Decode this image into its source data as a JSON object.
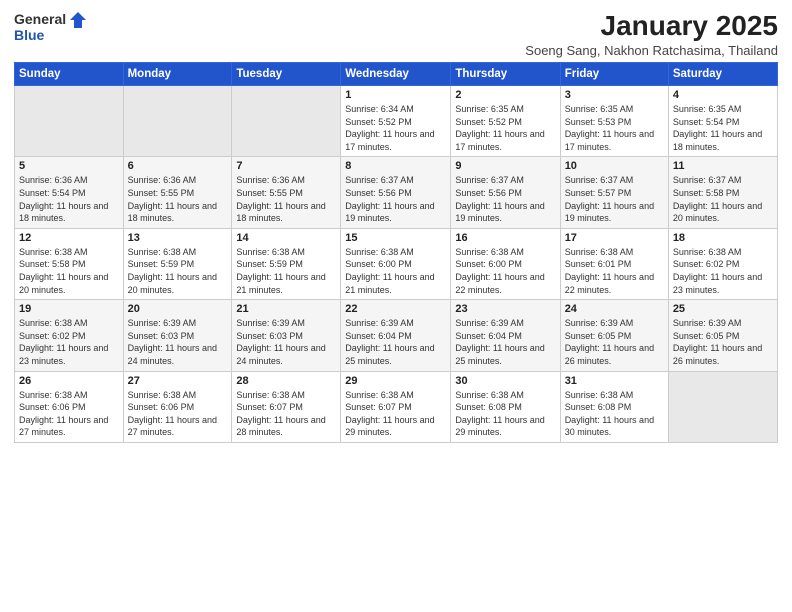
{
  "header": {
    "logo_general": "General",
    "logo_blue": "Blue",
    "title": "January 2025",
    "location": "Soeng Sang, Nakhon Ratchasima, Thailand"
  },
  "weekdays": [
    "Sunday",
    "Monday",
    "Tuesday",
    "Wednesday",
    "Thursday",
    "Friday",
    "Saturday"
  ],
  "weeks": [
    [
      {
        "day": "",
        "sunrise": "",
        "sunset": "",
        "daylight": ""
      },
      {
        "day": "",
        "sunrise": "",
        "sunset": "",
        "daylight": ""
      },
      {
        "day": "",
        "sunrise": "",
        "sunset": "",
        "daylight": ""
      },
      {
        "day": "1",
        "sunrise": "Sunrise: 6:34 AM",
        "sunset": "Sunset: 5:52 PM",
        "daylight": "Daylight: 11 hours and 17 minutes."
      },
      {
        "day": "2",
        "sunrise": "Sunrise: 6:35 AM",
        "sunset": "Sunset: 5:52 PM",
        "daylight": "Daylight: 11 hours and 17 minutes."
      },
      {
        "day": "3",
        "sunrise": "Sunrise: 6:35 AM",
        "sunset": "Sunset: 5:53 PM",
        "daylight": "Daylight: 11 hours and 17 minutes."
      },
      {
        "day": "4",
        "sunrise": "Sunrise: 6:35 AM",
        "sunset": "Sunset: 5:54 PM",
        "daylight": "Daylight: 11 hours and 18 minutes."
      }
    ],
    [
      {
        "day": "5",
        "sunrise": "Sunrise: 6:36 AM",
        "sunset": "Sunset: 5:54 PM",
        "daylight": "Daylight: 11 hours and 18 minutes."
      },
      {
        "day": "6",
        "sunrise": "Sunrise: 6:36 AM",
        "sunset": "Sunset: 5:55 PM",
        "daylight": "Daylight: 11 hours and 18 minutes."
      },
      {
        "day": "7",
        "sunrise": "Sunrise: 6:36 AM",
        "sunset": "Sunset: 5:55 PM",
        "daylight": "Daylight: 11 hours and 18 minutes."
      },
      {
        "day": "8",
        "sunrise": "Sunrise: 6:37 AM",
        "sunset": "Sunset: 5:56 PM",
        "daylight": "Daylight: 11 hours and 19 minutes."
      },
      {
        "day": "9",
        "sunrise": "Sunrise: 6:37 AM",
        "sunset": "Sunset: 5:56 PM",
        "daylight": "Daylight: 11 hours and 19 minutes."
      },
      {
        "day": "10",
        "sunrise": "Sunrise: 6:37 AM",
        "sunset": "Sunset: 5:57 PM",
        "daylight": "Daylight: 11 hours and 19 minutes."
      },
      {
        "day": "11",
        "sunrise": "Sunrise: 6:37 AM",
        "sunset": "Sunset: 5:58 PM",
        "daylight": "Daylight: 11 hours and 20 minutes."
      }
    ],
    [
      {
        "day": "12",
        "sunrise": "Sunrise: 6:38 AM",
        "sunset": "Sunset: 5:58 PM",
        "daylight": "Daylight: 11 hours and 20 minutes."
      },
      {
        "day": "13",
        "sunrise": "Sunrise: 6:38 AM",
        "sunset": "Sunset: 5:59 PM",
        "daylight": "Daylight: 11 hours and 20 minutes."
      },
      {
        "day": "14",
        "sunrise": "Sunrise: 6:38 AM",
        "sunset": "Sunset: 5:59 PM",
        "daylight": "Daylight: 11 hours and 21 minutes."
      },
      {
        "day": "15",
        "sunrise": "Sunrise: 6:38 AM",
        "sunset": "Sunset: 6:00 PM",
        "daylight": "Daylight: 11 hours and 21 minutes."
      },
      {
        "day": "16",
        "sunrise": "Sunrise: 6:38 AM",
        "sunset": "Sunset: 6:00 PM",
        "daylight": "Daylight: 11 hours and 22 minutes."
      },
      {
        "day": "17",
        "sunrise": "Sunrise: 6:38 AM",
        "sunset": "Sunset: 6:01 PM",
        "daylight": "Daylight: 11 hours and 22 minutes."
      },
      {
        "day": "18",
        "sunrise": "Sunrise: 6:38 AM",
        "sunset": "Sunset: 6:02 PM",
        "daylight": "Daylight: 11 hours and 23 minutes."
      }
    ],
    [
      {
        "day": "19",
        "sunrise": "Sunrise: 6:38 AM",
        "sunset": "Sunset: 6:02 PM",
        "daylight": "Daylight: 11 hours and 23 minutes."
      },
      {
        "day": "20",
        "sunrise": "Sunrise: 6:39 AM",
        "sunset": "Sunset: 6:03 PM",
        "daylight": "Daylight: 11 hours and 24 minutes."
      },
      {
        "day": "21",
        "sunrise": "Sunrise: 6:39 AM",
        "sunset": "Sunset: 6:03 PM",
        "daylight": "Daylight: 11 hours and 24 minutes."
      },
      {
        "day": "22",
        "sunrise": "Sunrise: 6:39 AM",
        "sunset": "Sunset: 6:04 PM",
        "daylight": "Daylight: 11 hours and 25 minutes."
      },
      {
        "day": "23",
        "sunrise": "Sunrise: 6:39 AM",
        "sunset": "Sunset: 6:04 PM",
        "daylight": "Daylight: 11 hours and 25 minutes."
      },
      {
        "day": "24",
        "sunrise": "Sunrise: 6:39 AM",
        "sunset": "Sunset: 6:05 PM",
        "daylight": "Daylight: 11 hours and 26 minutes."
      },
      {
        "day": "25",
        "sunrise": "Sunrise: 6:39 AM",
        "sunset": "Sunset: 6:05 PM",
        "daylight": "Daylight: 11 hours and 26 minutes."
      }
    ],
    [
      {
        "day": "26",
        "sunrise": "Sunrise: 6:38 AM",
        "sunset": "Sunset: 6:06 PM",
        "daylight": "Daylight: 11 hours and 27 minutes."
      },
      {
        "day": "27",
        "sunrise": "Sunrise: 6:38 AM",
        "sunset": "Sunset: 6:06 PM",
        "daylight": "Daylight: 11 hours and 27 minutes."
      },
      {
        "day": "28",
        "sunrise": "Sunrise: 6:38 AM",
        "sunset": "Sunset: 6:07 PM",
        "daylight": "Daylight: 11 hours and 28 minutes."
      },
      {
        "day": "29",
        "sunrise": "Sunrise: 6:38 AM",
        "sunset": "Sunset: 6:07 PM",
        "daylight": "Daylight: 11 hours and 29 minutes."
      },
      {
        "day": "30",
        "sunrise": "Sunrise: 6:38 AM",
        "sunset": "Sunset: 6:08 PM",
        "daylight": "Daylight: 11 hours and 29 minutes."
      },
      {
        "day": "31",
        "sunrise": "Sunrise: 6:38 AM",
        "sunset": "Sunset: 6:08 PM",
        "daylight": "Daylight: 11 hours and 30 minutes."
      },
      {
        "day": "",
        "sunrise": "",
        "sunset": "",
        "daylight": ""
      }
    ]
  ]
}
